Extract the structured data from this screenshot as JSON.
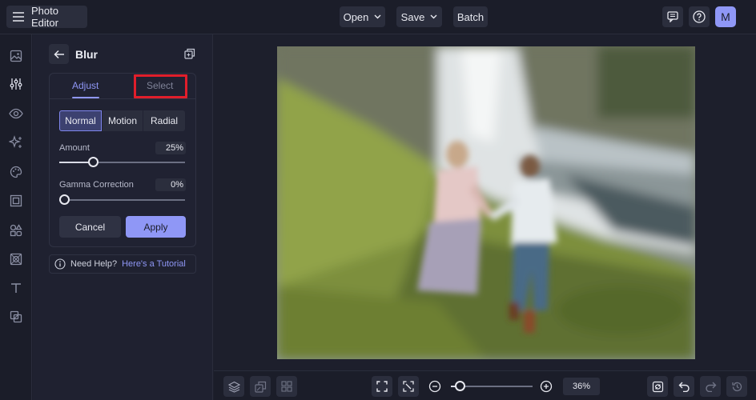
{
  "app": {
    "title": "Photo Editor"
  },
  "topbar": {
    "open_label": "Open",
    "save_label": "Save",
    "batch_label": "Batch",
    "avatar_initial": "M"
  },
  "rail": {
    "icons": [
      "image-icon",
      "adjust-sliders-icon",
      "eye-icon",
      "sparkle-icon",
      "palette-icon",
      "frame-icon",
      "shapes-icon",
      "texture-icon",
      "text-icon",
      "overlay-icon"
    ]
  },
  "panel": {
    "title": "Blur",
    "tabs": {
      "adjust": "Adjust",
      "select": "Select"
    },
    "modes": {
      "normal": "Normal",
      "motion": "Motion",
      "radial": "Radial"
    },
    "amount": {
      "label": "Amount",
      "value": "25%",
      "level": 0.25
    },
    "gamma": {
      "label": "Gamma Correction",
      "value": "0%",
      "level": 0
    },
    "cancel_label": "Cancel",
    "apply_label": "Apply",
    "help": {
      "text": "Need Help?",
      "link": "Here's a Tutorial"
    }
  },
  "bottombar": {
    "zoom": "36%",
    "zoom_level": 0.06
  },
  "colors": {
    "accent": "#8f97f6",
    "highlight": "#e01e2b",
    "background": "#1d1f2c"
  }
}
